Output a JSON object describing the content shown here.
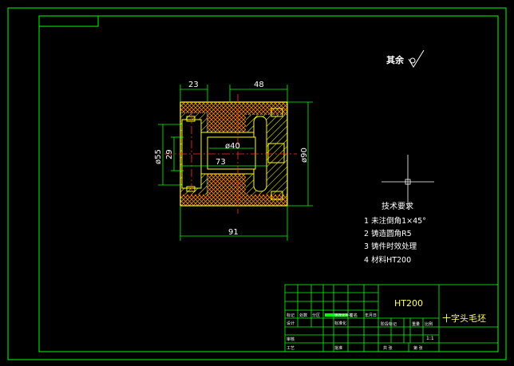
{
  "roughness_note": "其余",
  "dimensions": {
    "d23": "23",
    "d48": "48",
    "d55": "ø55",
    "d29": "29",
    "d40": "ø40",
    "d73": "73",
    "d90": "ø90",
    "d91": "91"
  },
  "tech_requirements": {
    "title": "技术要求",
    "items": [
      "1  未注倒角1×45°",
      "2  铸造圆角R5",
      "3  铸件时效处理",
      "4  材料HT200"
    ]
  },
  "title_block": {
    "material": "HT200",
    "part_name": "十字头毛坯",
    "scale": "1:1",
    "labels": {
      "mark": "标记",
      "count": "处数",
      "zone": "分区",
      "change_doc": "更改文件号",
      "signature": "签名",
      "date": "年月日",
      "design": "设计",
      "standardize": "标准化",
      "review": "审核",
      "process": "工艺",
      "approve": "批准",
      "stage_mark": "阶段标记",
      "weight": "重量",
      "scale_label": "比例",
      "sheet_total": "共    张",
      "sheet_no": "第    张"
    }
  },
  "colors": {
    "border": "#00ff00",
    "outline": "#ffff00",
    "centerline": "#ff0000",
    "hatch_a": "#ffff00",
    "hatch_b": "#ff6a00",
    "dimension": "#00ff00",
    "text": "#ffffff"
  }
}
